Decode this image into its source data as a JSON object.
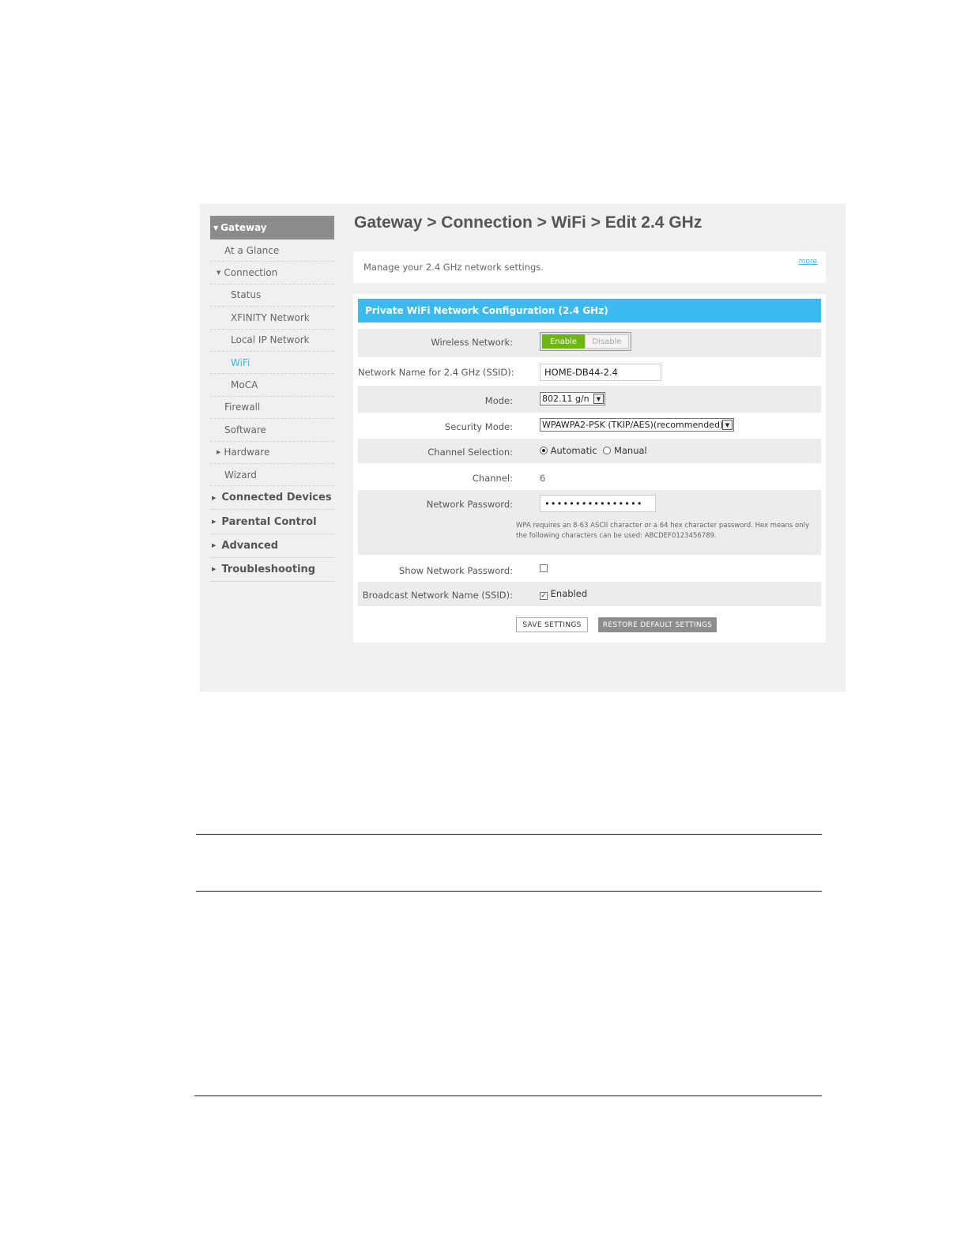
{
  "title": "Gateway > Connection > WiFi > Edit 2.4 GHz",
  "description": "Manage your 2.4 GHz network settings.",
  "more_link": "more",
  "sidebar": {
    "gateway": "Gateway",
    "at_a_glance": "At a Glance",
    "connection": "Connection",
    "status": "Status",
    "xfinity_network": "XFINITY Network",
    "local_ip_network": "Local IP Network",
    "wifi": "WiFi",
    "moca": "MoCA",
    "firewall": "Firewall",
    "software": "Software",
    "hardware": "Hardware",
    "wizard": "Wizard",
    "connected_devices": "Connected Devices",
    "parental_control": "Parental Control",
    "advanced": "Advanced",
    "troubleshooting": "Troubleshooting"
  },
  "panel": {
    "heading": "Private WiFi Network Configuration (2.4 GHz)",
    "wireless_network": {
      "label": "Wireless Network:",
      "enable": "Enable",
      "disable": "Disable"
    },
    "ssid": {
      "label": "Network Name for 2.4 GHz (SSID):",
      "value": "HOME-DB44-2.4"
    },
    "mode": {
      "label": "Mode:",
      "value": "802.11 g/n"
    },
    "security_mode": {
      "label": "Security Mode:",
      "value": "WPAWPA2-PSK (TKIP/AES)(recommended)"
    },
    "channel_selection": {
      "label": "Channel Selection:",
      "automatic": "Automatic",
      "manual": "Manual"
    },
    "channel": {
      "label": "Channel:",
      "value": "6"
    },
    "password": {
      "label": "Network Password:",
      "value": "••••••••••••••••",
      "help": "WPA requires an 8-63 ASCII character or a 64 hex character password. Hex means only the following characters can be used: ABCDEF0123456789."
    },
    "show_password": {
      "label": "Show Network Password:"
    },
    "broadcast_ssid": {
      "label": "Broadcast Network Name (SSID):",
      "enabled": "Enabled"
    },
    "save_button": "SAVE SETTINGS",
    "restore_button": "RESTORE DEFAULT SETTINGS"
  },
  "colors": {
    "accent": "#3cb9ef",
    "enable_green": "#6cb513",
    "sidebar_header": "#8c8c8c"
  }
}
